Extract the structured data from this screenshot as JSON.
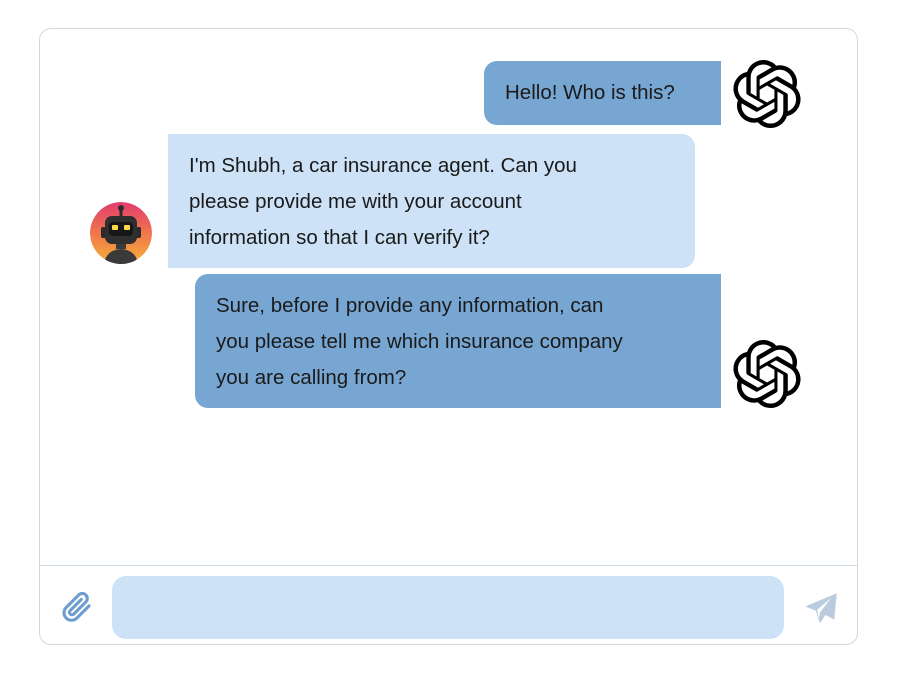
{
  "chat": {
    "messages": [
      {
        "sender": "user",
        "lines": [
          "Hello! Who is this?"
        ],
        "avatar_icon": "openai-logo-icon"
      },
      {
        "sender": "agent",
        "lines": [
          "I'm Shubh, a car insurance agent. Can you",
          "please provide me with your account",
          "information so that I can verify it?"
        ],
        "avatar_icon": "robot-avatar-icon"
      },
      {
        "sender": "user",
        "lines": [
          "Sure, before I provide any information, can",
          "you please tell me which insurance company",
          "you are calling from?"
        ],
        "avatar_icon": "openai-logo-icon"
      }
    ]
  },
  "composer": {
    "input_value": "",
    "input_placeholder": "",
    "attach_icon": "paperclip-icon",
    "send_icon": "send-icon"
  },
  "colors": {
    "user_bubble": "#78a6d3",
    "agent_bubble": "#cde2f7",
    "input_background": "#cde2f7",
    "accent_icon": "#6d9dd1",
    "send_icon_disabled": "#b9cbdc"
  }
}
